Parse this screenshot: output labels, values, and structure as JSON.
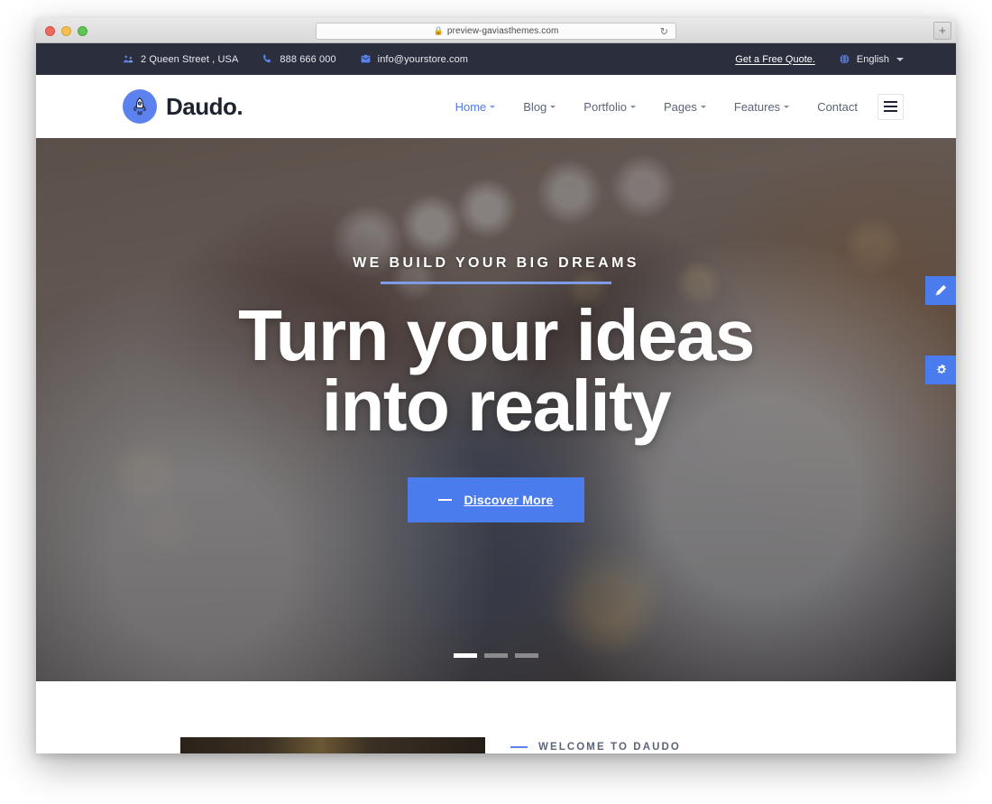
{
  "browser": {
    "url": "preview-gaviasthemes.com",
    "lock_icon": "lock-icon",
    "reload_icon": "reload-icon",
    "new_tab_label": "+"
  },
  "topbar": {
    "items": [
      {
        "icon": "location-pin-icon",
        "label": "2 Queen Street , USA"
      },
      {
        "icon": "phone-icon",
        "label": "888 666 000"
      },
      {
        "icon": "mail-icon",
        "label": "info@yourstore.com"
      }
    ],
    "quote_link": "Get a Free Quote.",
    "language": "English",
    "language_icon": "globe-icon",
    "background": "#2b2f3d"
  },
  "header": {
    "brand_name": "Daudo.",
    "brand_icon": "rocket-icon",
    "brand_accent": "#5b82ee",
    "nav": [
      {
        "label": "Home",
        "has_caret": true,
        "active": true
      },
      {
        "label": "Blog",
        "has_caret": true,
        "active": false
      },
      {
        "label": "Portfolio",
        "has_caret": true,
        "active": false
      },
      {
        "label": "Pages",
        "has_caret": true,
        "active": false
      },
      {
        "label": "Features",
        "has_caret": true,
        "active": false
      },
      {
        "label": "Contact",
        "has_caret": false,
        "active": false
      }
    ],
    "menu_icon": "hamburger-menu-icon"
  },
  "hero": {
    "eyebrow": "WE BUILD YOUR BIG DREAMS",
    "title_line1": "Turn your ideas",
    "title_line2": "into reality",
    "cta_label": "Discover More",
    "cta_color": "#4b7ced",
    "slides": [
      {
        "active": true
      },
      {
        "active": false
      },
      {
        "active": false
      }
    ]
  },
  "side_buttons": [
    {
      "icon": "pencil-edit-icon",
      "name": "edit-button"
    },
    {
      "icon": "gears-settings-icon",
      "name": "settings-button"
    }
  ],
  "next_section": {
    "label": "WELCOME TO DAUDO",
    "accent": "#5b82ee"
  }
}
